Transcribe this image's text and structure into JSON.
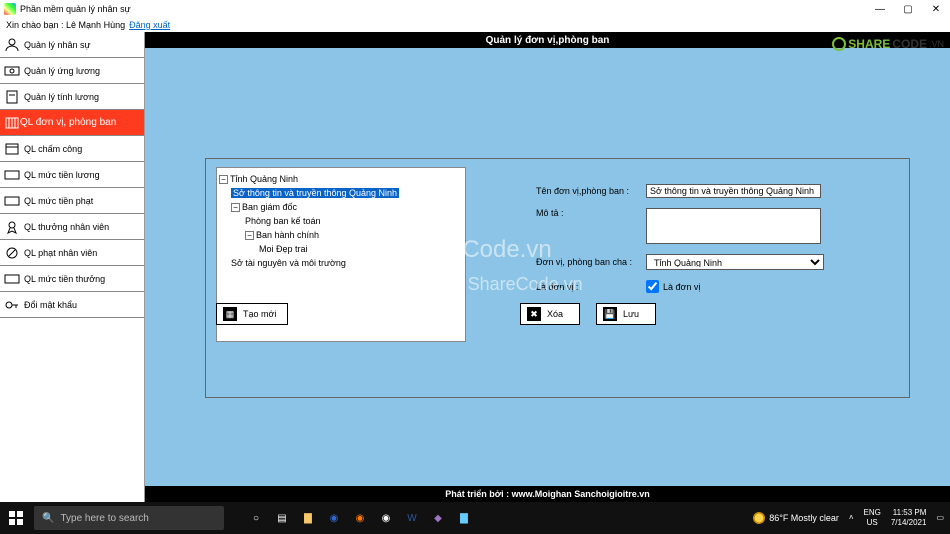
{
  "window": {
    "title": "Phần mềm quản lý nhân sự",
    "min": "—",
    "max": "▢",
    "close": "✕"
  },
  "greet": {
    "hello": "Xin chào bạn : Lê Mạnh Hùng",
    "logout": "Đăng xuất"
  },
  "blackbar": "Quản lý đơn vị,phòng ban",
  "logo": {
    "brand": "SHARE",
    "brand2": "CODE",
    "tld": ".VN"
  },
  "sidebar": {
    "items": [
      {
        "label": "Quản lý nhân sự"
      },
      {
        "label": "Quản lý ứng lương"
      },
      {
        "label": "Quản lý tính lương"
      },
      {
        "label": "QL đơn vị, phòng ban",
        "active": true
      },
      {
        "label": "QL chấm công"
      },
      {
        "label": "QL mức tiền lương"
      },
      {
        "label": "QL mức tiền phạt"
      },
      {
        "label": "QL thưởng nhân viên"
      },
      {
        "label": "QL phạt nhân viên"
      },
      {
        "label": "QL mức tiền thưởng"
      },
      {
        "label": "Đổi mật khẩu"
      }
    ]
  },
  "tree": {
    "n0": "Tỉnh Quảng Ninh",
    "n1": "Sở thông tin và truyền thông Quảng Ninh",
    "n2": "Ban giám đốc",
    "n3": "Phòng ban kế toán",
    "n4": "Ban hành chính",
    "n5": "Moi Đẹp trai",
    "n6": "Sở tài nguyên và môi trường"
  },
  "form": {
    "l_name": "Tên đơn vị,phòng ban :",
    "v_name": "Sở thông tin và truyền thông Quảng Ninh",
    "l_desc": "Mô tả :",
    "v_desc": "",
    "l_parent": "Đơn vị, phòng ban cha :",
    "v_parent": "Tỉnh Quảng Ninh",
    "l_isunit": "Là đơn vị :",
    "chk_label": "Là đơn vị",
    "btn_new": "Tạo mới",
    "btn_del": "Xóa",
    "btn_save": "Lưu"
  },
  "footer": "Phát triển bởi : www.Moighan Sanchoigioitre.vn",
  "watermark": {
    "l1": "ShareCode.vn",
    "l2": "Copyright © ShareCode.vn"
  },
  "taskbar": {
    "search_placeholder": "Type here to search",
    "weather": "86°F  Mostly clear",
    "lang1": "ENG",
    "lang2": "US",
    "time": "11:53 PM",
    "date": "7/14/2021"
  }
}
